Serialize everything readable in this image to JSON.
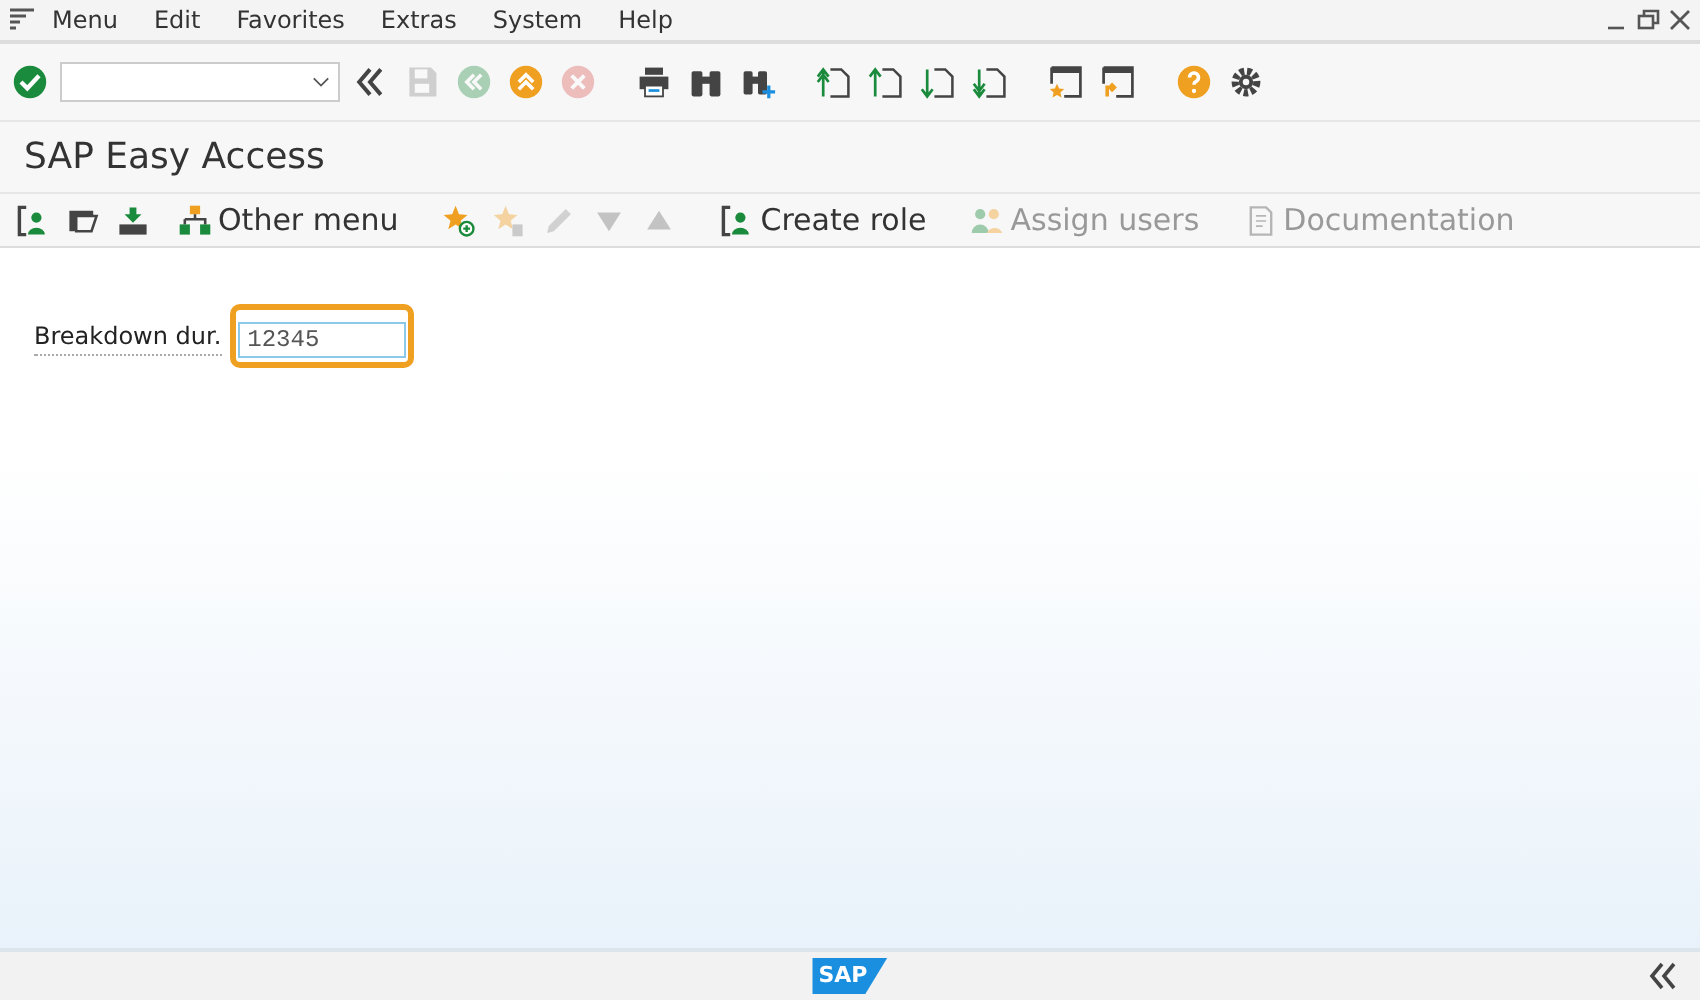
{
  "menu_bar": {
    "items": [
      "Menu",
      "Edit",
      "Favorites",
      "Extras",
      "System",
      "Help"
    ]
  },
  "window_controls": [
    {
      "kind": "minimize"
    },
    {
      "kind": "restore"
    },
    {
      "kind": "close"
    }
  ],
  "system_toolbar": [
    {
      "kind": "enter",
      "disabled": false
    },
    {
      "kind": "command-field"
    },
    {
      "kind": "collapse",
      "disabled": false
    },
    {
      "kind": "save",
      "disabled": true
    },
    {
      "kind": "back",
      "disabled": true
    },
    {
      "kind": "exit",
      "disabled": false
    },
    {
      "kind": "cancel",
      "disabled": true
    },
    {
      "kind": "print",
      "disabled": false
    },
    {
      "kind": "find",
      "disabled": false
    },
    {
      "kind": "find-next",
      "disabled": false
    },
    {
      "kind": "first-page",
      "disabled": false
    },
    {
      "kind": "prev-page",
      "disabled": false
    },
    {
      "kind": "next-page",
      "disabled": false
    },
    {
      "kind": "last-page",
      "disabled": false
    },
    {
      "kind": "new-session",
      "disabled": false
    },
    {
      "kind": "shortcut",
      "disabled": false
    },
    {
      "kind": "help",
      "disabled": false
    },
    {
      "kind": "settings",
      "disabled": false
    }
  ],
  "title": "SAP Easy Access",
  "app_toolbar": [
    {
      "kind": "user-menu",
      "disabled": false
    },
    {
      "kind": "sap-menu",
      "disabled": false
    },
    {
      "kind": "workplace",
      "disabled": false
    },
    {
      "kind": "other-menu",
      "label": "Other menu",
      "disabled": false
    },
    {
      "kind": "add-favorite",
      "disabled": false
    },
    {
      "kind": "delete-favorite",
      "disabled": true
    },
    {
      "kind": "edit",
      "disabled": true
    },
    {
      "kind": "move-down",
      "disabled": true
    },
    {
      "kind": "move-up",
      "disabled": true
    },
    {
      "kind": "create-role",
      "label": "Create role",
      "disabled": false
    },
    {
      "kind": "assign-users",
      "label": "Assign users",
      "disabled": true
    },
    {
      "kind": "documentation",
      "label": "Documentation",
      "disabled": true
    }
  ],
  "form": {
    "label": "Breakdown dur.",
    "value": "12345",
    "focused": true
  },
  "status_bar": {
    "logo": "SAP"
  }
}
